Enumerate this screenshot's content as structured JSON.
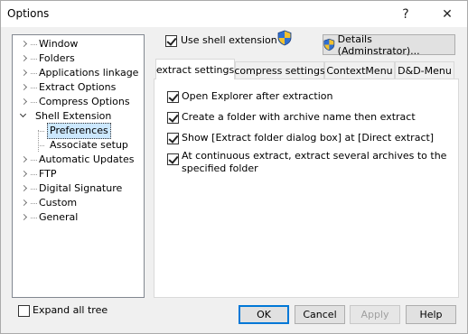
{
  "window": {
    "title": "Options",
    "help_glyph": "?",
    "close_glyph": "✕"
  },
  "tree": {
    "items": [
      {
        "label": "Window",
        "state": "collapsed"
      },
      {
        "label": "Folders",
        "state": "collapsed"
      },
      {
        "label": "Applications linkage",
        "state": "collapsed"
      },
      {
        "label": "Extract Options",
        "state": "collapsed"
      },
      {
        "label": "Compress Options",
        "state": "collapsed"
      },
      {
        "label": "Shell Extension",
        "state": "expanded"
      },
      {
        "label": "Preferences",
        "state": "child-selected"
      },
      {
        "label": "Associate setup",
        "state": "child"
      },
      {
        "label": "Automatic Updates",
        "state": "collapsed"
      },
      {
        "label": "FTP",
        "state": "collapsed"
      },
      {
        "label": "Digital Signature",
        "state": "collapsed"
      },
      {
        "label": "Custom",
        "state": "collapsed"
      },
      {
        "label": "General",
        "state": "collapsed"
      }
    ]
  },
  "expand_all": {
    "label": "Expand all tree",
    "checked": false
  },
  "shell": {
    "use_label": "Use shell extension",
    "use_checked": true,
    "details_label": "Details (Adminstrator)..."
  },
  "tabs": [
    {
      "label": "extract settings",
      "active": true
    },
    {
      "label": "compress settings",
      "active": false
    },
    {
      "label": "ContextMenu",
      "active": false
    },
    {
      "label": "D&D-Menu",
      "active": false
    }
  ],
  "options": [
    {
      "label": "Open Explorer after extraction",
      "checked": true
    },
    {
      "label": "Create a folder with archive name then extract",
      "checked": true
    },
    {
      "label": "Show [Extract folder dialog box] at [Direct extract]",
      "checked": true
    },
    {
      "label_line1": "At continuous extract, extract several archives to the",
      "label_line2": "specified folder",
      "checked": true
    }
  ],
  "footer": {
    "ok": "OK",
    "cancel": "Cancel",
    "apply": "Apply",
    "help": "Help"
  },
  "colors": {
    "selection": "#cce8ff",
    "accent": "#0078d7",
    "shield_blue": "#2f6fd1",
    "shield_yellow": "#f2c12e"
  }
}
